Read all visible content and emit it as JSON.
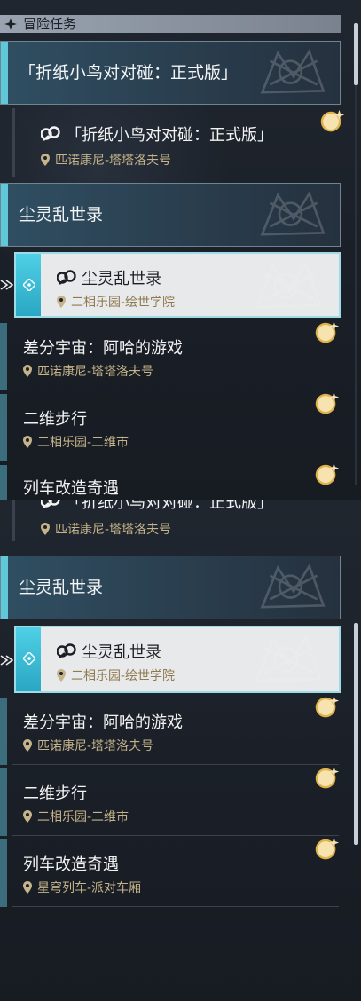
{
  "header": {
    "title": "冒险任务"
  },
  "panel1": {
    "top_chapter": {
      "label": "「折纸小鸟对对碰：正式版」"
    },
    "sub_quest": {
      "title": "「折纸小鸟对对碰：正式版」",
      "location": "匹诺康尼-塔塔洛夫号",
      "badge": "新"
    },
    "chapter": {
      "label": "尘灵乱世录"
    },
    "selected_quest": {
      "title": "尘灵乱世录",
      "location": "二相乐园-绘世学院"
    },
    "quests": [
      {
        "title": "差分宇宙：阿哈的游戏",
        "location": "匹诺康尼-塔塔洛夫号",
        "badge": "新"
      },
      {
        "title": "二维步行",
        "location": "二相乐园-二维市",
        "badge": "新"
      },
      {
        "title": "列车改造奇遇",
        "badge": "新"
      }
    ]
  },
  "panel2": {
    "sub_quest": {
      "title": "「折纸小鸟对对碰：正式版」",
      "location": "匹诺康尼-塔塔洛夫号"
    },
    "chapter": {
      "label": "尘灵乱世录"
    },
    "selected_quest": {
      "title": "尘灵乱世录",
      "location": "二相乐园-绘世学院"
    },
    "quests": [
      {
        "title": "差分宇宙：阿哈的游戏",
        "location": "匹诺康尼-塔塔洛夫号",
        "badge": "新"
      },
      {
        "title": "二维步行",
        "location": "二相乐园-二维市",
        "badge": "新"
      },
      {
        "title": "列车改造奇遇",
        "location": "星穹列车-派对车厢",
        "badge": "新"
      }
    ]
  },
  "colors": {
    "accent_cyan": "#5fc9d9",
    "location_gold": "#c5b38a",
    "badge_gold": "#e0b24a"
  }
}
